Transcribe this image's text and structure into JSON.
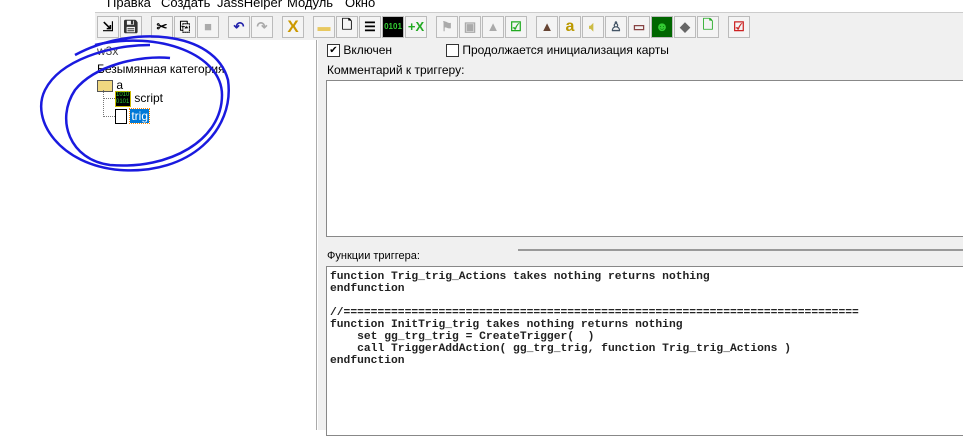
{
  "menu": [
    "Правка",
    "Создать",
    "JassHelper",
    "Модуль",
    "Окно"
  ],
  "toolbar": {
    "buttons": [
      "import",
      "save",
      "cut",
      "copy",
      "paste",
      "undo",
      "redo",
      "delete",
      "new-category",
      "new-trigger",
      "new-comment",
      "new-script",
      "new-variable",
      "run-map",
      "test-map",
      "disabled",
      "checklist",
      "terrain",
      "object-editor",
      "sound",
      "unit",
      "campaign",
      "ai",
      "import-manager",
      "object",
      "export",
      "validate"
    ]
  },
  "tree": {
    "root": "w3x",
    "category": "Безымянная категория",
    "folder": "a",
    "items": [
      {
        "label": "script",
        "icon": "script-icon"
      },
      {
        "label": "trig",
        "icon": "trigger-icon",
        "selected": true
      }
    ]
  },
  "trigger": {
    "enabled_label": "Включен",
    "enabled": true,
    "init_label": "Продолжается инициализация карты",
    "init": false,
    "comment_label": "Комментарий к триггеру:",
    "comment": "",
    "functions_label": "Функции триггера:"
  },
  "code": [
    "function Trig_trig_Actions takes nothing returns nothing",
    "endfunction",
    "",
    "//============================================================================",
    "function InitTrig_trig takes nothing returns nothing",
    "    set gg_trg_trig = CreateTrigger(  )",
    "    call TriggerAddAction( gg_trg_trig, function Trig_trig_Actions )",
    "endfunction"
  ],
  "colors": {
    "selection": "#0078d7",
    "annotation": "#1a1adf"
  }
}
